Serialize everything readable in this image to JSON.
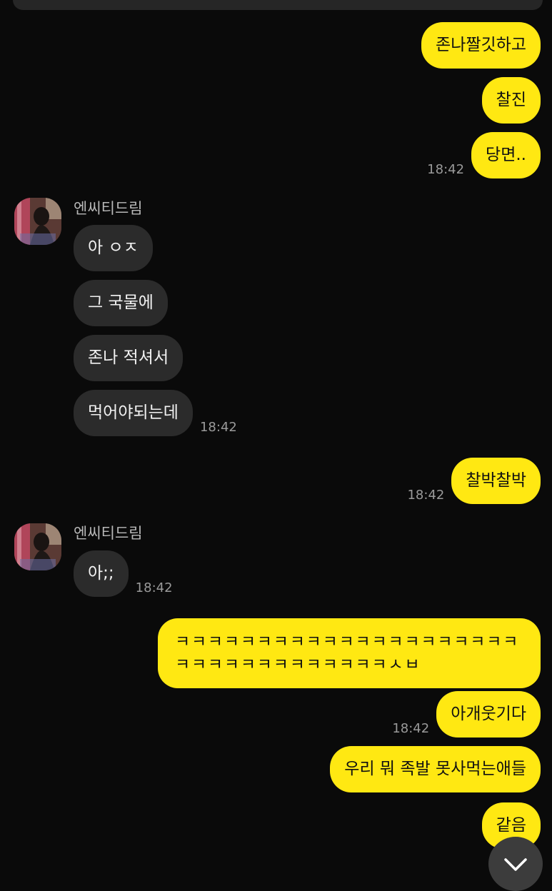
{
  "messages": [
    {
      "text": "존나짤깃하고"
    },
    {
      "text": "찰진"
    },
    {
      "text": "당면..",
      "time": "18:42"
    },
    {
      "sender": "엔씨티드림"
    },
    {
      "text": "아 ㅇㅈ"
    },
    {
      "text": "그 국물에"
    },
    {
      "text": "존나 적셔서"
    },
    {
      "text": "먹어야되는데",
      "time": "18:42"
    },
    {
      "text": "찰박찰박",
      "time": "18:42"
    },
    {
      "sender": "엔씨티드림"
    },
    {
      "text": "아;;",
      "time": "18:42"
    },
    {
      "text": "ㅋㅋㅋㅋㅋㅋㅋㅋㅋㅋㅋㅋㅋㅋㅋㅋㅋㅋㅋㅋㅋㅋㅋㅋㅋㅋㅋㅋㅋㅋㅋㅋㅋㅋㅅㅂ"
    },
    {
      "text": "아개웃기다",
      "time": "18:42"
    },
    {
      "text": "우리 뭐 족발 못사먹는애들"
    },
    {
      "text": "같음"
    }
  ],
  "colors": {
    "background": "#0a0a0a",
    "my_bubble": "#ffe812",
    "their_bubble": "#2b2b2b"
  },
  "icons": {
    "scroll_down": "chevron-down-icon"
  }
}
